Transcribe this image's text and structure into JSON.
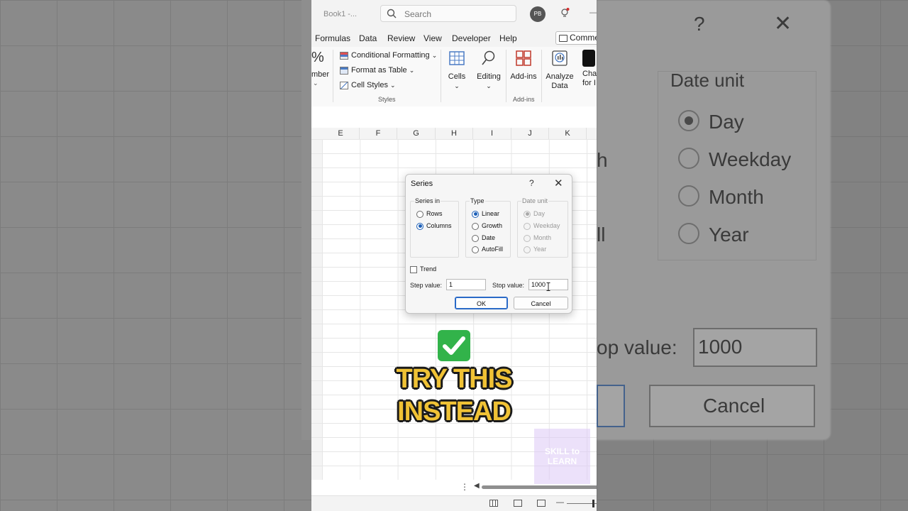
{
  "titlebar": {
    "book": "Book1  -...",
    "search_placeholder": "Search",
    "avatar": "PB"
  },
  "tabs": [
    "Formulas",
    "Data",
    "Review",
    "View",
    "Developer",
    "Help"
  ],
  "comments_label": "Comme",
  "ribbon": {
    "number_fragment": "%",
    "number_label": "mber",
    "conditional_formatting": "Conditional Formatting",
    "format_as_table": "Format as Table",
    "cell_styles": "Cell Styles",
    "styles_group": "Styles",
    "cells": "Cells",
    "editing": "Editing",
    "add_ins": "Add-ins",
    "add_ins_group": "Add-ins",
    "analyze_data_1": "Analyze",
    "analyze_data_2": "Data",
    "cha_1": "Cha",
    "cha_2": "for I"
  },
  "columns": [
    "E",
    "F",
    "G",
    "H",
    "I",
    "J",
    "K"
  ],
  "dialog": {
    "title": "Series",
    "help": "?",
    "close": "✕",
    "series_in": {
      "title": "Series in",
      "options": [
        "Rows",
        "Columns"
      ],
      "selected": "Columns"
    },
    "type": {
      "title": "Type",
      "options": [
        "Linear",
        "Growth",
        "Date",
        "AutoFill"
      ],
      "selected": "Linear"
    },
    "date_unit": {
      "title": "Date unit",
      "options": [
        "Day",
        "Weekday",
        "Month",
        "Year"
      ],
      "selected": "Day"
    },
    "trend_label": "Trend",
    "step_label": "Step value:",
    "step_value": "1",
    "stop_label": "Stop value:",
    "stop_value": "1000",
    "ok": "OK",
    "cancel": "Cancel"
  },
  "background": {
    "help": "?",
    "close": "✕",
    "date_unit": "Date unit",
    "options": [
      "Day",
      "Weekday",
      "Month",
      "Year"
    ],
    "stop_label": "op value:",
    "stop_value": "1000",
    "cancel": "Cancel",
    "left_frag_1": "h",
    "left_frag_2": "ll"
  },
  "overlay": {
    "line1": "TRY THIS",
    "line2": "INSTEAD"
  },
  "watermark": {
    "line1": "SKILL to",
    "line2": "LEARN"
  },
  "colors": {
    "accent": "#1d5fb7",
    "overlay_text": "#f0c235",
    "excel_green": "#217346"
  }
}
